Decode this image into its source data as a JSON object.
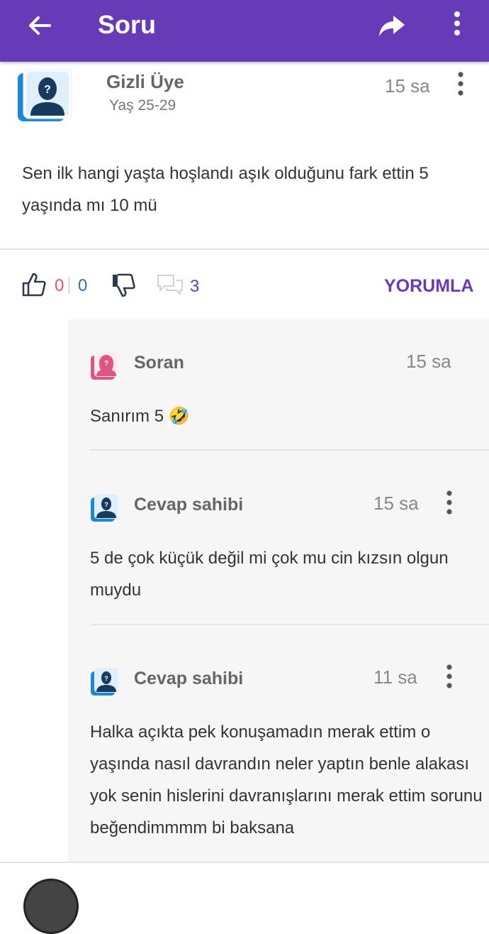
{
  "appbar": {
    "title": "Soru",
    "icons": [
      "arrow-left-icon",
      "share-icon",
      "more-vertical-icon"
    ],
    "bg": "#673ab7"
  },
  "question": {
    "author": "Gizli Üye",
    "age": "Yaş 25-29",
    "time": "15 sa",
    "text": "Sen ilk hangi yaşta hoşlandı aşık olduğunu fark ettin 5 yaşında mı 10 mü"
  },
  "actions": {
    "like_count": "0",
    "dislike_count": "0",
    "comment_count": "3",
    "comment_button": "YORUMLA",
    "accent": "#673ab7",
    "like_color": "#e2537f",
    "dislike_color": "#2f6fb2"
  },
  "comments": [
    {
      "author": "Soran",
      "time": "15 sa",
      "text": "Sanırım 5 🤣",
      "avatar": "female-avatar-icon"
    },
    {
      "author": "Cevap sahibi",
      "time": "15 sa",
      "text": "5 de çok küçük değil mi çok mu cin kızsın olgun muydu",
      "avatar": "male-avatar-icon"
    },
    {
      "author": "Cevap sahibi",
      "time": "11 sa",
      "text": "Halka açıkta pek konuşamadın merak ettim o yaşında nasıl davrandın neler yaptın benle alakası yok senin hislerini davranışlarını merak ettim sorunu beğendimmmm bi baksana",
      "avatar": "male-avatar-icon"
    }
  ]
}
